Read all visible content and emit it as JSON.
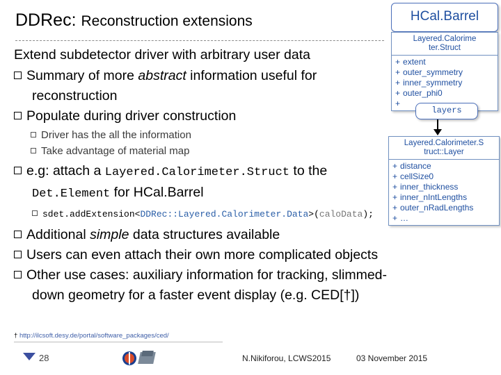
{
  "slide": {
    "title_main": "DDRec:",
    "title_sub": "Reconstruction extensions",
    "page_number": "28",
    "footer_author": "N.Nikiforou, LCWS2015",
    "footer_date": "03 November 2015",
    "footnote_dagger": "†",
    "footnote_url": "http://ilcsoft.desy.de/portal/software_packages/ced/"
  },
  "body": {
    "line1": "Extend subdetector driver with arbitrary user data",
    "b1_pre": "Summary of more ",
    "b1_em": "abstract",
    "b1_post": " information useful for",
    "b1_cont": "reconstruction",
    "b2": "Populate during driver construction",
    "b2_sub1": "Driver has the all the information",
    "b2_sub2": "Take advantage of material map",
    "b3_pre": "e.g: attach a ",
    "b3_code1": "Layered.Calorimeter.Struct",
    "b3_post": " to the",
    "b3_code2": "Det.Element",
    "b3_post2": " for HCal.Barrel",
    "code_line": "sdet.addExtension<DDRec::Layered.Calorimeter.Data>(caloData);",
    "code_obj": "sdet.addExtension<",
    "code_type": "DDRec::Layered.Calorimeter.Data",
    "code_tail": ">(",
    "code_arg": "caloData",
    "code_end": ");",
    "b4_pre": "Additional ",
    "b4_em": "simple",
    "b4_post": " data structures available",
    "b5": "Users can even attach their own more complicated objects",
    "b6": "Other use cases: auxiliary information for tracking, slimmed-",
    "b6_cont": "down geometry for a faster event display (e.g. CED[†])"
  },
  "diagram": {
    "hcal_label": "HCal.Barrel",
    "struct_box": {
      "header_line1": "Layered.Calorime",
      "header_line2": "ter.Struct",
      "rows": [
        "extent",
        "outer_symmetry",
        "inner_symmetry",
        "outer_phi0",
        ""
      ]
    },
    "layers_pill": "layers",
    "layer_box": {
      "header_line1": "Layered.Calorimeter.S",
      "header_line2": "truct::Layer",
      "rows": [
        "distance",
        "cellSize0",
        "inner_thickness",
        "inner_nIntLengths",
        "outer_nRadLengths",
        "…"
      ]
    }
  },
  "colors": {
    "accent_blue": "#1f4fa0",
    "box_border": "#7090c0",
    "footnote_link": "#3f5fa8"
  }
}
